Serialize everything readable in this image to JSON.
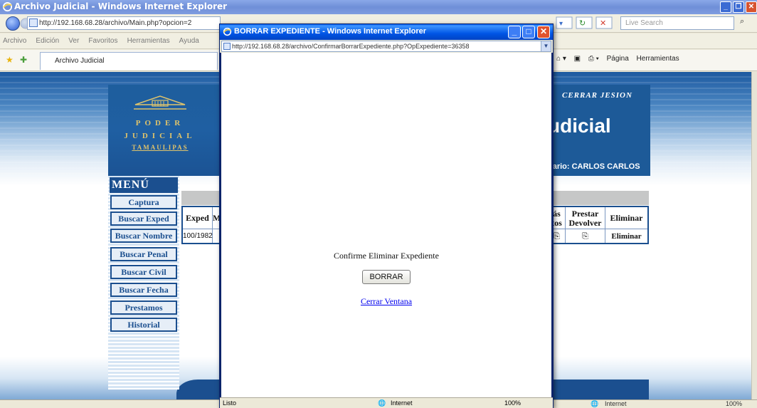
{
  "main_window": {
    "title": "Archivo Judicial - Windows Internet Explorer",
    "url": "http://192.168.68.28/archivo/Main.php?opcion=2",
    "search_placeholder": "Live Search",
    "menubar": [
      "Archivo",
      "Edición",
      "Ver",
      "Favoritos",
      "Herramientas",
      "Ayuda"
    ],
    "tab_label": "Archivo Judicial",
    "tools": {
      "page": "Página",
      "tools": "Herramientas"
    },
    "status_zone": "Internet",
    "status_zoom": "100%"
  },
  "page": {
    "logo_lines": [
      "PODER",
      "JUDICIAL",
      "TAMAULIPAS"
    ],
    "logout": "CERRAR JESION",
    "heading": "udicial",
    "user": "uario: CARLOS CARLOS",
    "menu_title": "MENÚ",
    "menu_items": [
      "Captura",
      "Buscar Exped",
      "Buscar Nombre",
      "Buscar Penal",
      "Buscar Civil",
      "Buscar Fecha",
      "Prestamos",
      "Historial"
    ],
    "table": {
      "headers": [
        "Exped",
        "M",
        "ás tos",
        "Prestar Devolver",
        "Eliminar"
      ],
      "row": [
        "100/1982",
        "",
        "",
        "",
        "Eliminar"
      ]
    }
  },
  "popup": {
    "title": "BORRAR EXPEDIENTE - Windows Internet Explorer",
    "url": "http://192.168.68.28/archivo/ConfirmarBorrarExpediente.php?OpExpediente=36358",
    "confirm_text": "Confirme Eliminar Expediente",
    "delete_button": "BORRAR",
    "close_link": "Cerrar Ventana",
    "status_left": "Listo",
    "status_zone": "Internet",
    "status_zoom": "100%"
  }
}
